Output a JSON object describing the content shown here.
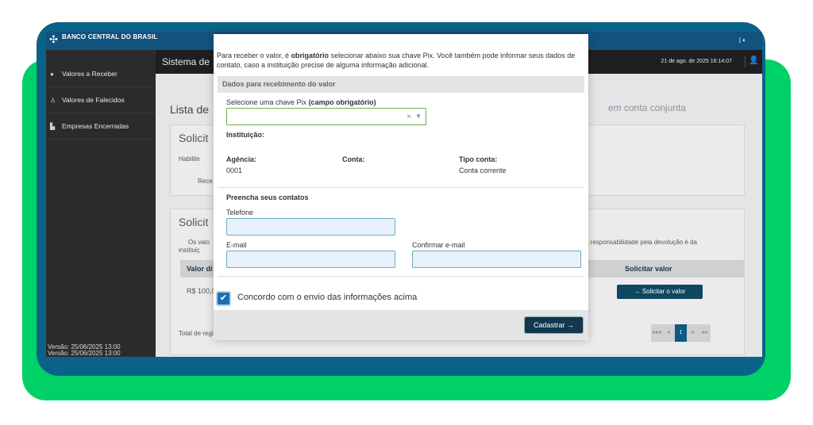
{
  "topbar": {
    "bank_name": "BANCO CENTRAL DO BRASIL",
    "right_glyph": "| ◐"
  },
  "header": {
    "system_title": "Sistema de",
    "datetime": "21 de ago. de 2025 16:14:07"
  },
  "sidebar": {
    "items": [
      {
        "label": "Valores a Receber",
        "icon": "chat-bubble-icon"
      },
      {
        "label": "Valores de Falecidos",
        "icon": "person-icon"
      },
      {
        "label": "Empresas Encerradas",
        "icon": "factory-icon"
      }
    ],
    "version_1": "Versão:  25/06/2025 13:00",
    "version_2": "Versão:  25/06/2025 13:00"
  },
  "background": {
    "list_title": "Lista de",
    "card1_title": "Solicit",
    "card1_line1": "Habilite",
    "card1_line2": "Rece",
    "card2_title": "Solicit",
    "card2_info_left": "Os valo",
    "card2_info_left2": "instituiç",
    "card2_info_right": "a responsabilidade pela devolução é da",
    "conjunta": "em conta conjunta",
    "table_head_left": "Valor di",
    "table_head_right": "Solicitar valor",
    "row_value": "R$ 100,0",
    "solicitar_button": "→  Solicitar o valor",
    "total_label": "Total de regi",
    "pager": [
      "«««",
      "«",
      "1",
      "»",
      "»»"
    ]
  },
  "modal": {
    "intro_1": "Para receber o valor, é ",
    "intro_bold": "obrigatório",
    "intro_2": " selecionar abaixo sua chave Pix. Você também pode informar seus dados de contato, caso a instituição precise de alguma informação adicional.",
    "section_title": "Dados para recebimento do valor",
    "pix_label": "Selecione uma chave Pix ",
    "pix_label_bold": "(campo obrigatório)",
    "instituicao_label": "Instituição:",
    "agencia_label": "Agência:",
    "agencia_value": "0001",
    "conta_label": "Conta:",
    "tipo_conta_label": "Tipo conta:",
    "tipo_conta_value": "Conta corrente",
    "contacts_title": "Preencha seus contatos",
    "telefone_label": "Telefone",
    "email_label": "E-mail",
    "confirm_email_label": "Confirmar e-mail",
    "checkbox_label": "Concordo com o envio das informações acima",
    "submit_label": "Cadastrar →"
  }
}
